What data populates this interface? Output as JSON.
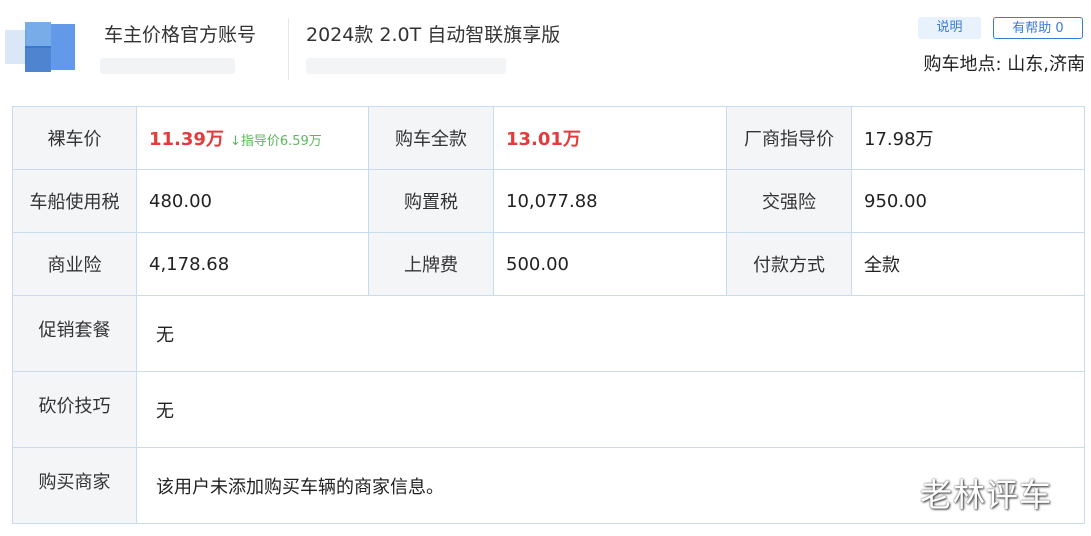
{
  "header": {
    "username": "车主价格官方账号",
    "model": "2024款 2.0T 自动智联旗享版",
    "explain_label": "说明",
    "help_label": "有帮助 0",
    "location": "购车地点: 山东,济南"
  },
  "table": {
    "row1": {
      "bare_label": "裸车价",
      "bare_value": "11.39万",
      "bare_hint": "↓指导价6.59万",
      "total_label": "购车全款",
      "total_value": "13.01万",
      "msrp_label": "厂商指导价",
      "msrp_value": "17.98万"
    },
    "row2": {
      "tax_label": "车船使用税",
      "tax_value": "480.00",
      "purchase_tax_label": "购置税",
      "purchase_tax_value": "10,077.88",
      "insurance_label": "交强险",
      "insurance_value": "950.00"
    },
    "row3": {
      "commercial_label": "商业险",
      "commercial_value": "4,178.68",
      "plate_label": "上牌费",
      "plate_value": "500.00",
      "payment_label": "付款方式",
      "payment_value": "全款"
    },
    "promo": {
      "label": "促销套餐",
      "value": "无"
    },
    "bargain": {
      "label": "砍价技巧",
      "value": "无"
    },
    "dealer": {
      "label": "购买商家",
      "value": "该用户未添加购买车辆的商家信息。"
    }
  },
  "watermark": "老林评车",
  "colors": {
    "accent": "#3a7bd5",
    "price": "#e33b3b",
    "hint": "#5cb85c",
    "border": "#c9dbee"
  }
}
